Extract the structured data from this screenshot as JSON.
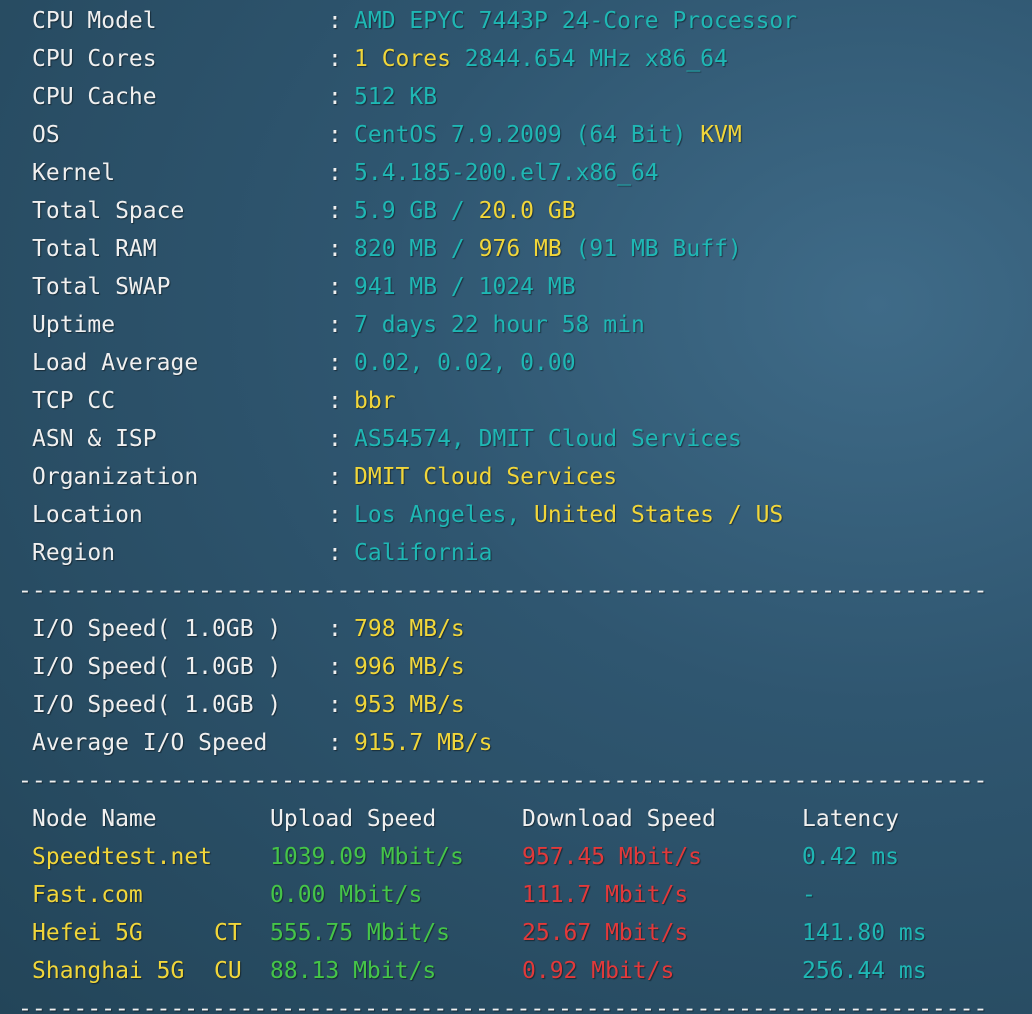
{
  "sysinfo": [
    {
      "label": "CPU Model",
      "parts": [
        {
          "t": "AMD EPYC 7443P 24-Core Processor",
          "c": "cyan"
        }
      ]
    },
    {
      "label": "CPU Cores",
      "parts": [
        {
          "t": "1 Cores",
          "c": "yellow"
        },
        {
          "t": " 2844.654 MHz x86_64",
          "c": "cyan"
        }
      ]
    },
    {
      "label": "CPU Cache",
      "parts": [
        {
          "t": "512 KB",
          "c": "cyan"
        }
      ]
    },
    {
      "label": "OS",
      "parts": [
        {
          "t": "CentOS 7.9.2009 (64 Bit) ",
          "c": "cyan"
        },
        {
          "t": "KVM",
          "c": "yellow"
        }
      ]
    },
    {
      "label": "Kernel",
      "parts": [
        {
          "t": "5.4.185-200.el7.x86_64",
          "c": "cyan"
        }
      ]
    },
    {
      "label": "Total Space",
      "parts": [
        {
          "t": "5.9 GB / ",
          "c": "cyan"
        },
        {
          "t": "20.0 GB",
          "c": "yellow"
        }
      ]
    },
    {
      "label": "Total RAM",
      "parts": [
        {
          "t": "820 MB / ",
          "c": "cyan"
        },
        {
          "t": "976 MB",
          "c": "yellow"
        },
        {
          "t": " (91 MB Buff)",
          "c": "cyan"
        }
      ]
    },
    {
      "label": "Total SWAP",
      "parts": [
        {
          "t": "941 MB / 1024 MB",
          "c": "cyan"
        }
      ]
    },
    {
      "label": "Uptime",
      "parts": [
        {
          "t": "7 days 22 hour 58 min",
          "c": "cyan"
        }
      ]
    },
    {
      "label": "Load Average",
      "parts": [
        {
          "t": "0.02, 0.02, 0.00",
          "c": "cyan"
        }
      ]
    },
    {
      "label": "TCP CC",
      "parts": [
        {
          "t": "bbr",
          "c": "yellow"
        }
      ]
    },
    {
      "label": "ASN & ISP",
      "parts": [
        {
          "t": "AS54574, DMIT Cloud Services",
          "c": "cyan"
        }
      ]
    },
    {
      "label": "Organization",
      "parts": [
        {
          "t": "DMIT Cloud Services",
          "c": "yellow"
        }
      ]
    },
    {
      "label": "Location",
      "parts": [
        {
          "t": "Los Angeles, ",
          "c": "cyan"
        },
        {
          "t": "United States / US",
          "c": "yellow"
        }
      ]
    },
    {
      "label": "Region",
      "parts": [
        {
          "t": "California",
          "c": "cyan"
        }
      ]
    }
  ],
  "separator": "----------------------------------------------------------------------",
  "colon": ":",
  "io": [
    {
      "label": "I/O Speed( 1.0GB )",
      "value": "798 MB/s"
    },
    {
      "label": "I/O Speed( 1.0GB )",
      "value": "996 MB/s"
    },
    {
      "label": "I/O Speed( 1.0GB )",
      "value": "953 MB/s"
    },
    {
      "label": "Average I/O Speed",
      "value": "915.7 MB/s"
    }
  ],
  "speedtest": {
    "headers": [
      "Node Name",
      "Upload Speed",
      "Download Speed",
      "Latency"
    ],
    "rows": [
      {
        "node": "Speedtest.net",
        "isp": "",
        "upload": "1039.09 Mbit/s",
        "download": "957.45 Mbit/s",
        "latency": "0.42 ms"
      },
      {
        "node": "Fast.com",
        "isp": "",
        "upload": "0.00 Mbit/s",
        "download": "111.7 Mbit/s",
        "latency": "-"
      },
      {
        "node": "Hefei 5G",
        "isp": "CT",
        "upload": "555.75 Mbit/s",
        "download": "25.67 Mbit/s",
        "latency": "141.80 ms"
      },
      {
        "node": "Shanghai 5G",
        "isp": "CU",
        "upload": "88.13 Mbit/s",
        "download": "0.92 Mbit/s",
        "latency": "256.44 ms"
      }
    ]
  },
  "colors": {
    "cyan": "#1fb7b4",
    "yellow": "#f1d63a",
    "green": "#45c548",
    "red": "#e2393a",
    "label": "#f0f0f0"
  }
}
